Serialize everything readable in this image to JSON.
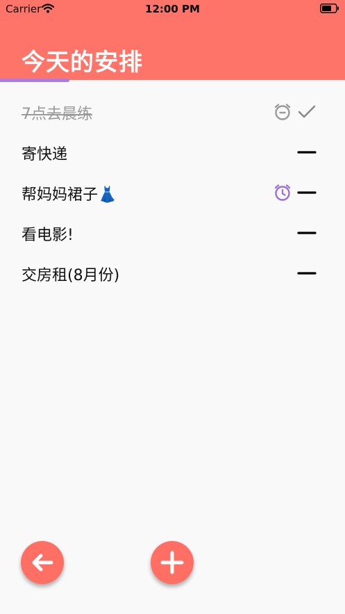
{
  "status_bar": {
    "carrier": "Carrier",
    "time": "12:00 PM"
  },
  "header": {
    "title": "今天的安排",
    "accent_color": "#ff7468",
    "tab_indicator_color": "#a87be6"
  },
  "tasks": [
    {
      "text": "7点去晨练",
      "done": true,
      "alarm": "alarm-muted-icon",
      "action": "checkmark-icon"
    },
    {
      "text": "寄快递",
      "done": false,
      "alarm": null,
      "action": "minus-icon"
    },
    {
      "text": "帮妈妈裙子👗",
      "done": false,
      "alarm": "alarm-clock-icon",
      "action": "minus-icon"
    },
    {
      "text": "看电影!",
      "done": false,
      "alarm": null,
      "action": "minus-icon"
    },
    {
      "text": "交房租(8月份)",
      "done": false,
      "alarm": null,
      "action": "minus-icon"
    }
  ],
  "fab": {
    "back_icon": "arrow-left-icon",
    "add_icon": "plus-icon",
    "color": "#ff6f64"
  }
}
